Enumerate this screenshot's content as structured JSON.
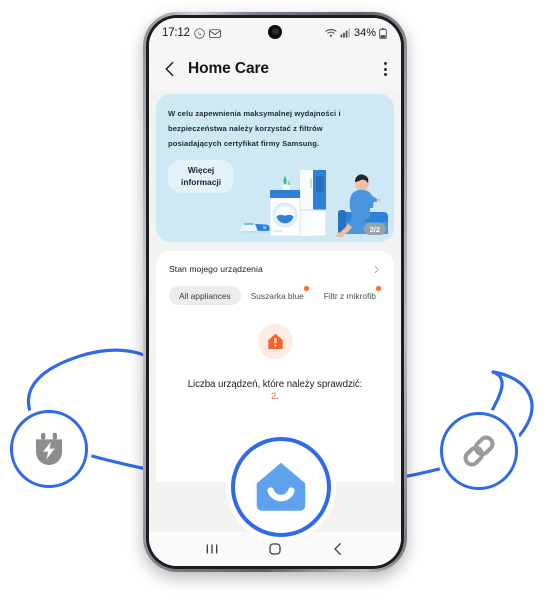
{
  "phone": {
    "status_bar": {
      "time": "17:12",
      "icons_left": [
        "whatsapp-icon",
        "email-icon"
      ],
      "icons_right": [
        "wifi-icon",
        "signal-icon"
      ],
      "battery": "34%"
    },
    "app_header": {
      "back_icon": "chevron-left-icon",
      "title": "Home Care",
      "menu_icon": "kebab-menu-icon"
    },
    "banner": {
      "message": "W celu zapewnienia maksymalnej wydajności i bezpieczeństwa należy korzystać z filtrów posiadających certyfikat firmy Samsung.",
      "button_line1": "Więcej",
      "button_line2": "informacji",
      "page_indicator": "2/2",
      "illustration": "home-appliances-illustration",
      "background_color": "#cfe9f4"
    },
    "device_status": {
      "section_label": "Stan mojego urządzenia",
      "chevron_icon": "chevron-right-icon",
      "chips": [
        {
          "label": "All appliances",
          "selected": true,
          "badge": false
        },
        {
          "label": "Suszarka blue",
          "selected": false,
          "badge": true
        },
        {
          "label": "Filtr z mikrofib",
          "selected": false,
          "badge": true
        }
      ],
      "warning_icon": "home-alert-icon",
      "warning_color": "#f2672a",
      "warning_text": "Liczba urządzeń, które należy sprawdzić:",
      "warning_count": "2",
      "warning_count_suffix": "."
    },
    "nav_bar": {
      "recents_icon": "recents-icon",
      "home_icon": "home-icon",
      "back_icon": "back-icon"
    }
  },
  "callouts": {
    "accent_color": "#2f6ae8",
    "left_badge": {
      "icon": "power-plug-icon"
    },
    "right_badge": {
      "icon": "link-chain-icon"
    },
    "center_badge": {
      "icon": "smartthings-home-icon",
      "color": "#5fa3ef"
    }
  }
}
